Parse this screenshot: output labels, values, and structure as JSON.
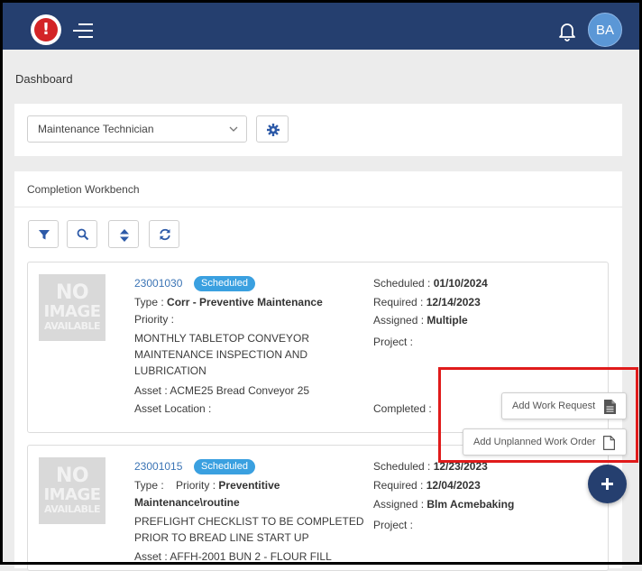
{
  "header": {
    "logo_glyph": "!",
    "avatar_initials": "BA"
  },
  "page": {
    "title": "Dashboard"
  },
  "role": {
    "selected": "Maintenance Technician"
  },
  "workbench": {
    "title": "Completion Workbench"
  },
  "no_image": {
    "line1": "NO",
    "line2": "IMAGE",
    "line3": "AVAILABLE"
  },
  "labels": {
    "type": "Type :",
    "priority": "Priority :",
    "asset": "Asset :",
    "asset_location": "Asset Location :",
    "scheduled": "Scheduled :",
    "required": "Required :",
    "assigned": "Assigned :",
    "project": "Project :",
    "completed": "Completed :"
  },
  "work_orders": [
    {
      "number": "23001030",
      "status": "Scheduled",
      "type": "Corr - Preventive Maintenance",
      "description_lines": [
        "MONTHLY TABLETOP CONVEYOR",
        "MAINTENANCE INSPECTION AND",
        "LUBRICATION"
      ],
      "asset": "ACME25 Bread Conveyor 25",
      "scheduled": "01/10/2024",
      "required": "12/14/2023",
      "assigned": "Multiple"
    },
    {
      "number": "23001015",
      "status": "Scheduled",
      "type_line1": "Preventitive",
      "type_line2": "Maintenance\\routine",
      "description_lines": [
        "PREFLIGHT CHECKLIST TO BE COMPLETED",
        "PRIOR TO BREAD LINE START UP"
      ],
      "asset": "AFFH-2001 BUN 2 - FLOUR FILL",
      "scheduled": "12/23/2023",
      "required": "12/04/2023",
      "assigned": "Blm Acmebaking"
    }
  ],
  "actions": {
    "add_work_request": "Add Work Request",
    "add_unplanned_work_order": "Add Unplanned Work Order"
  },
  "colors": {
    "header": "#253f6f",
    "badge": "#3aa0e0",
    "link": "#3b74b5",
    "highlight": "#e01b1b"
  }
}
